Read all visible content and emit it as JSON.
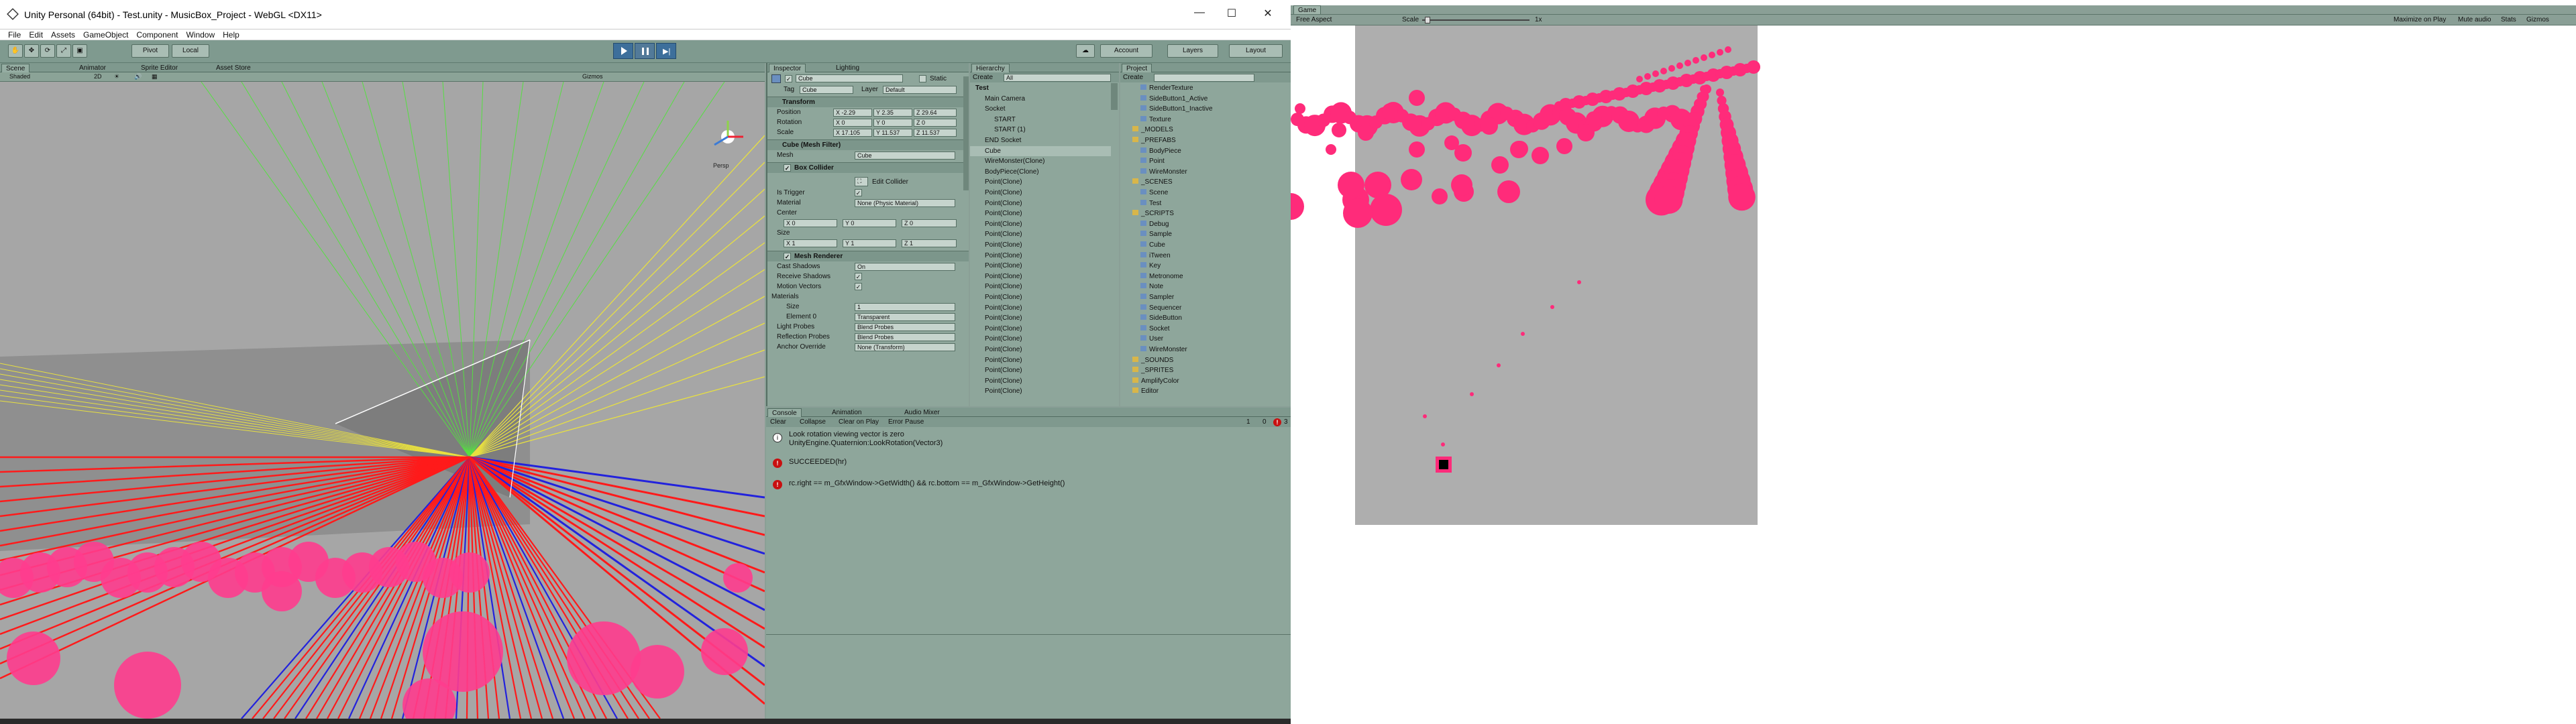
{
  "window": {
    "title": "Unity Personal (64bit) - Test.unity - MusicBox_Project - WebGL <DX11>",
    "min": "—",
    "max": "☐",
    "close": "✕"
  },
  "menu": [
    "File",
    "Edit",
    "Assets",
    "GameObject",
    "Component",
    "Window",
    "Help"
  ],
  "toolbar": {
    "pivot": "Pivot",
    "local": "Local",
    "account": "Account",
    "layers": "Layers",
    "layout": "Layout"
  },
  "scene": {
    "tabs": [
      "Scene",
      "Animator",
      "Sprite Editor",
      "Asset Store"
    ],
    "shading": "Shaded",
    "mode2d": "2D",
    "gizmos": "Gizmos",
    "persp": "Persp"
  },
  "inspector": {
    "tabs": [
      "Inspector",
      "Lighting"
    ],
    "object_name": "Cube",
    "static_label": "Static",
    "tag_label": "Tag",
    "tag_value": "Cube",
    "layer_label": "Layer",
    "layer_value": "Default",
    "transform": {
      "title": "Transform",
      "position_label": "Position",
      "position": [
        "X -2.29",
        "Y 2.35",
        "Z 29.64"
      ],
      "rotation_label": "Rotation",
      "rotation": [
        "X 0",
        "Y 0",
        "Z 0"
      ],
      "scale_label": "Scale",
      "scale": [
        "X 17.105",
        "Y 11.537",
        "Z 11.537"
      ]
    },
    "mesh_filter": {
      "title": "Cube (Mesh Filter)",
      "mesh_label": "Mesh",
      "mesh_value": "Cube"
    },
    "box_collider": {
      "title": "Box Collider",
      "edit": "Edit Collider",
      "is_trigger": "Is Trigger",
      "material_label": "Material",
      "material_value": "None (Physic Material)",
      "center_label": "Center",
      "center": [
        "X 0",
        "Y 0",
        "Z 0"
      ],
      "size_label": "Size",
      "size": [
        "X 1",
        "Y 1",
        "Z 1"
      ]
    },
    "mesh_renderer": {
      "title": "Mesh Renderer",
      "cast_shadows": "Cast Shadows",
      "cast_shadows_value": "On",
      "receive_shadows": "Receive Shadows",
      "motion_vectors": "Motion Vectors",
      "materials": "Materials",
      "size_label": "Size",
      "size_value": "1",
      "element0_label": "Element 0",
      "element0_value": "Transparent",
      "light_probes": "Light Probes",
      "light_probes_value": "Blend Probes",
      "reflection_probes": "Reflection Probes",
      "reflection_probes_value": "Blend Probes",
      "anchor_override": "Anchor Override",
      "anchor_override_value": "None (Transform)"
    }
  },
  "hierarchy": {
    "tab": "Hierarchy",
    "create": "Create",
    "search": "All",
    "items": [
      "Test",
      "Main Camera",
      "Socket",
      "START",
      "START (1)",
      "END Socket",
      "Cube",
      "WireMonster(Clone)",
      "BodyPiece(Clone)",
      "Point(Clone)",
      "Point(Clone)",
      "Point(Clone)",
      "Point(Clone)",
      "Point(Clone)",
      "Point(Clone)",
      "Point(Clone)",
      "Point(Clone)",
      "Point(Clone)",
      "Point(Clone)",
      "Point(Clone)",
      "Point(Clone)",
      "Point(Clone)",
      "Point(Clone)",
      "Point(Clone)",
      "Point(Clone)",
      "Point(Clone)",
      "Point(Clone)",
      "Point(Clone)",
      "Point(Clone)",
      "Point(Clone)"
    ]
  },
  "project": {
    "tab": "Project",
    "create": "Create",
    "items": [
      "RenderTexture",
      "SideButton1_Active",
      "SideButton1_Inactive",
      "Texture",
      "_MODELS",
      "_PREFABS",
      "BodyPiece",
      "Point",
      "WireMonster",
      "_SCENES",
      "Scene",
      "Test",
      "_SCRIPTS",
      "Debug",
      "Sample",
      "Cube",
      "iTween",
      "Key",
      "Metronome",
      "Note",
      "Sampler",
      "Sequencer",
      "SideButton",
      "Socket",
      "User",
      "WireMonster",
      "_SOUNDS",
      "_SPRITES",
      "AmplifyColor",
      "Editor"
    ]
  },
  "console": {
    "tabs": [
      "Console",
      "Animation",
      "Audio Mixer"
    ],
    "buttons": [
      "Clear",
      "Collapse",
      "Clear on Play",
      "Error Pause"
    ],
    "counts": [
      "1",
      "0",
      "3"
    ],
    "messages": [
      {
        "type": "info",
        "text": "Look rotation viewing vector is zero",
        "sub": "UnityEngine.Quaternion:LookRotation(Vector3)"
      },
      {
        "type": "error",
        "text": "SUCCEEDED(hr)",
        "sub": ""
      },
      {
        "type": "error",
        "text": "rc.right == m_GfxWindow->GetWidth() && rc.bottom == m_GfxWindow->GetHeight()",
        "sub": ""
      }
    ]
  },
  "game": {
    "tab": "Game",
    "aspect": "Free Aspect",
    "scale_label": "Scale",
    "scale_value": "1x",
    "buttons": [
      "Maximize on Play",
      "Mute audio",
      "Stats",
      "Gizmos"
    ]
  },
  "colors": {
    "accent_pink": "#ff2b7a",
    "game_bg": "#aeaeae",
    "editor_bg": "#8ea69b"
  }
}
